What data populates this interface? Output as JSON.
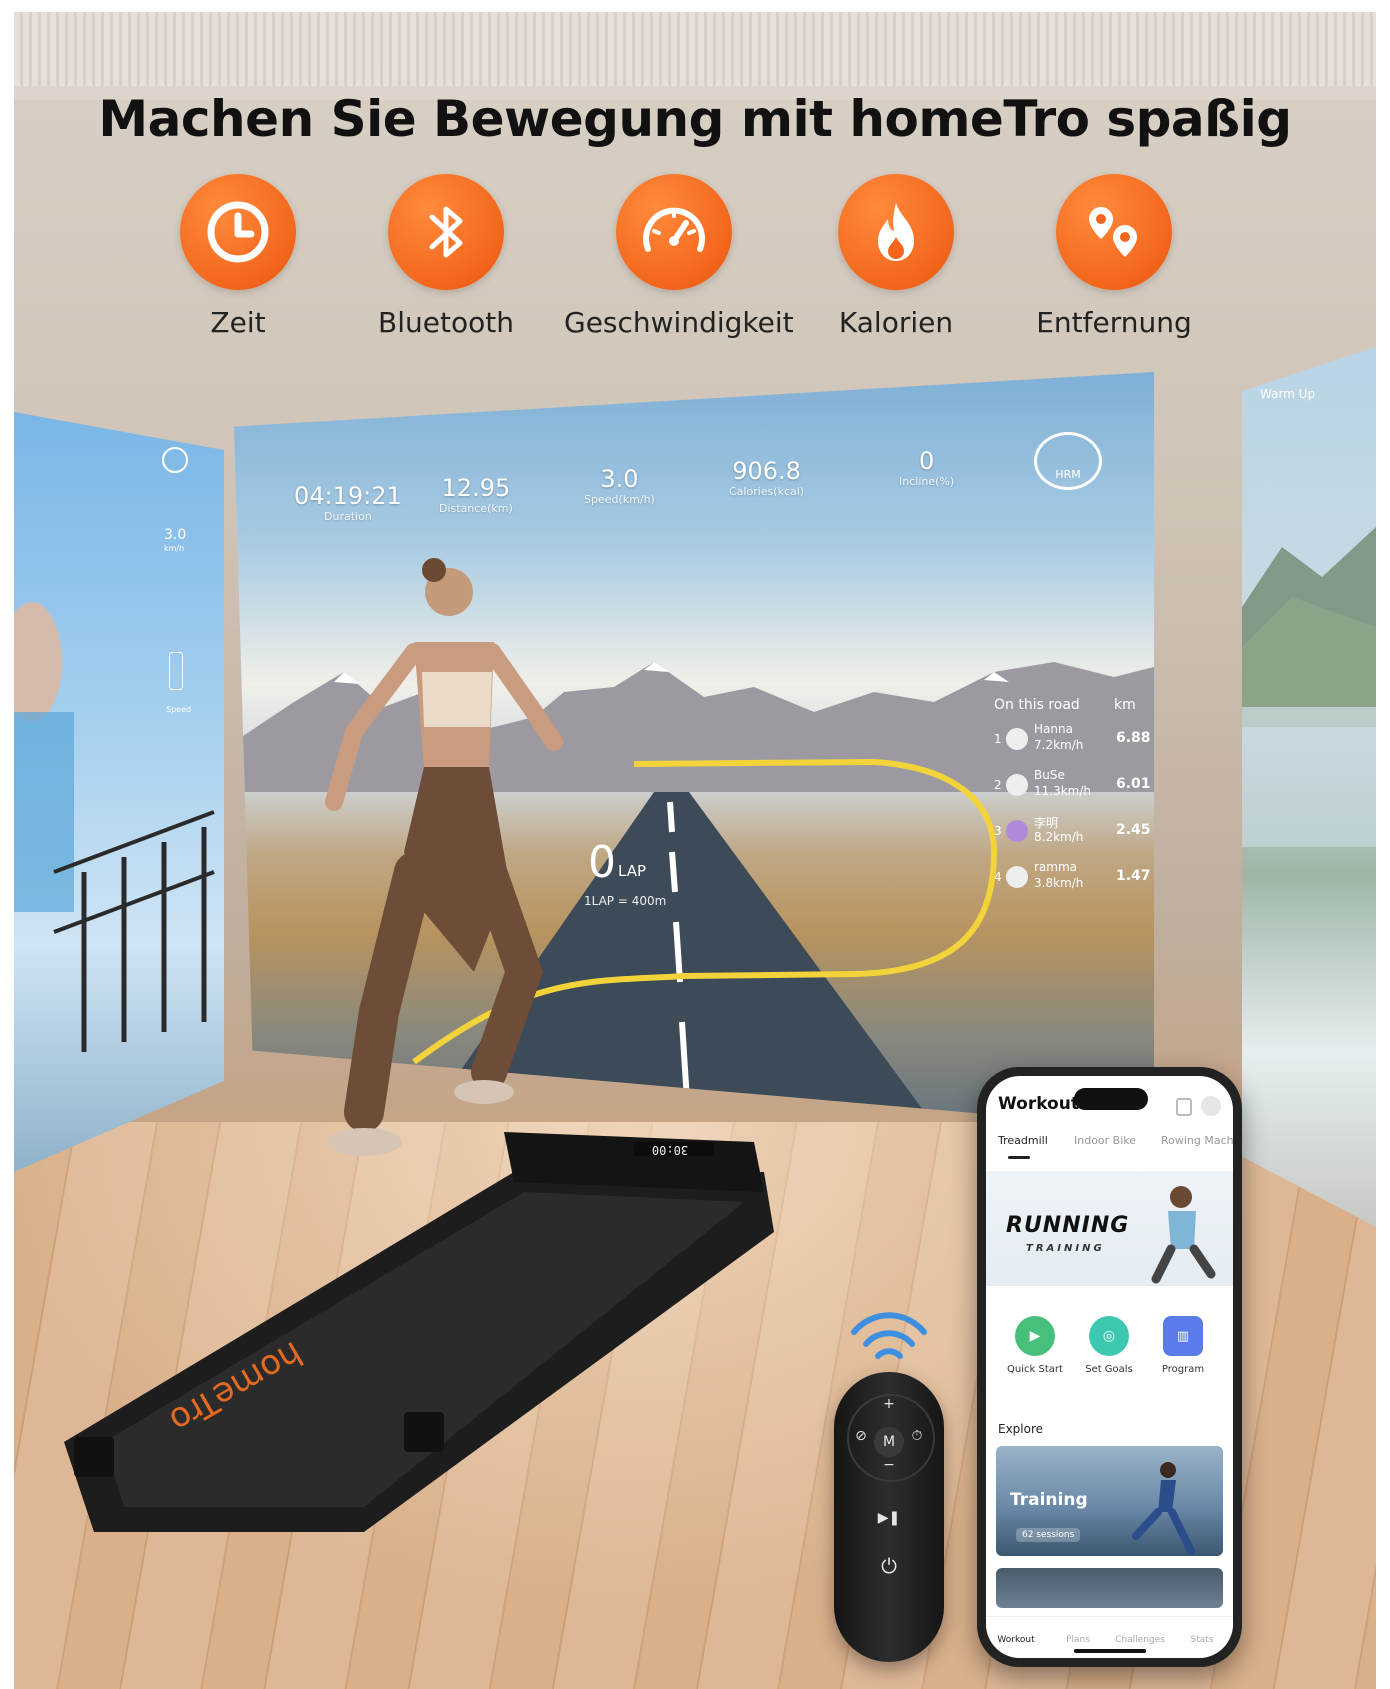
{
  "headline": "Machen Sie Bewegung mit homeTro spaßig",
  "features": [
    {
      "icon": "clock-icon",
      "label": "Zeit"
    },
    {
      "icon": "bluetooth-icon",
      "label": "Bluetooth"
    },
    {
      "icon": "speedometer-icon",
      "label": "Geschwindigkeit"
    },
    {
      "icon": "flame-icon",
      "label": "Kalorien"
    },
    {
      "icon": "location-pins-icon",
      "label": "Entfernung"
    }
  ],
  "colors": {
    "accent": "#f3661c",
    "track": "#f2d33a"
  },
  "screen": {
    "stats": [
      {
        "value": "04:19:21",
        "label": "Duration"
      },
      {
        "value": "12.95",
        "label": "Distance(km)"
      },
      {
        "value": "3.0",
        "label": "Speed(km/h)"
      },
      {
        "value": "906.8",
        "label": "Calories(kcal)"
      },
      {
        "value": "0",
        "label": "Incline(%)"
      }
    ],
    "hrm_label": "HRM",
    "lap_count": "0",
    "lap_label": "LAP",
    "lap_note": "1LAP = 400m",
    "leaderboard": {
      "title": "On this road",
      "unit": "km",
      "rows": [
        {
          "rank": "1",
          "name": "Hanna",
          "speed": "7.2km/h",
          "km": "6.88"
        },
        {
          "rank": "2",
          "name": "BuSe",
          "speed": "11.3km/h",
          "km": "6.01"
        },
        {
          "rank": "3",
          "name": "李明",
          "speed": "8.2km/h",
          "km": "2.45"
        },
        {
          "rank": "4",
          "name": "ramma",
          "speed": "3.8km/h",
          "km": "1.47"
        }
      ]
    }
  },
  "left_panel": {
    "speed": "3.0",
    "unit": "km/h",
    "speed_label": "Speed"
  },
  "right_panel": {
    "label": "Warm Up"
  },
  "treadmill": {
    "brand": "homeTro",
    "display": "30:00"
  },
  "remote": {
    "plus": "+",
    "minus": "−",
    "mode": "M"
  },
  "phone": {
    "title": "Workout",
    "tabs": [
      "Treadmill",
      "Indoor Bike",
      "Rowing Mach"
    ],
    "banner_title": "RUNNING",
    "banner_sub": "TRAINING",
    "actions": [
      "Quick Start",
      "Set Goals",
      "Program"
    ],
    "explore_label": "Explore",
    "card_title": "Training",
    "card_sub": "62 sessions",
    "nav": [
      "Workout",
      "Plans",
      "Challenges",
      "Stats"
    ]
  }
}
